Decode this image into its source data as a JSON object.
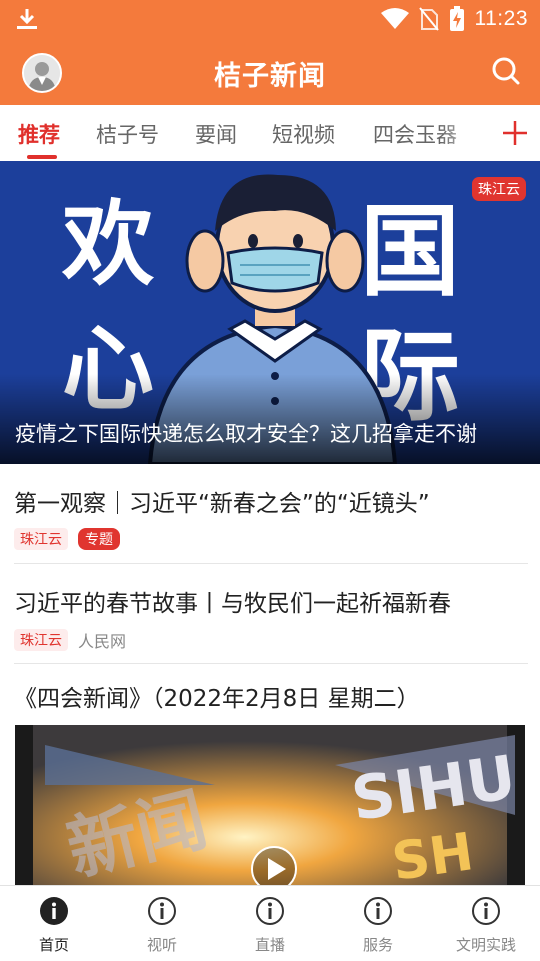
{
  "status_bar": {
    "time": "11:23",
    "icons": [
      "download-icon",
      "wifi-icon",
      "no-sim-icon",
      "battery-charging-icon"
    ]
  },
  "header": {
    "title": "桔子新闻",
    "avatar_icon": "user-avatar",
    "search_icon": "search-icon"
  },
  "tabs": {
    "items": [
      {
        "label": "推荐",
        "active": true
      },
      {
        "label": "桔子号",
        "active": false
      },
      {
        "label": "要闻",
        "active": false
      },
      {
        "label": "短视频",
        "active": false
      },
      {
        "label": "四会玉器",
        "active": false
      }
    ],
    "add_icon": "plus-icon"
  },
  "hero": {
    "source": "珠江云",
    "caption": "疫情之下国际快递怎么取才安全？这几招拿走不谢",
    "image_text": [
      "欢",
      "心",
      "国",
      "际"
    ]
  },
  "news": [
    {
      "title": "第一观察｜习近平“新春之会”的“近镜头”",
      "source": "珠江云",
      "badge": "专题",
      "extra": ""
    },
    {
      "title": "习近平的春节故事丨与牧民们一起祈福新春",
      "source": "珠江云",
      "badge": "",
      "extra": "人民网"
    }
  ],
  "video": {
    "title": "《四会新闻》（2022年2月8日 星期二）",
    "play_icon": "play-icon"
  },
  "bottom_nav": {
    "items": [
      {
        "label": "首页",
        "active": true
      },
      {
        "label": "视听",
        "active": false
      },
      {
        "label": "直播",
        "active": false
      },
      {
        "label": "服务",
        "active": false
      },
      {
        "label": "文明实践",
        "active": false
      }
    ]
  },
  "colors": {
    "brand_orange": "#f47a3c",
    "accent_red": "#e0302c",
    "hero_blue": "#1c3f9b"
  }
}
